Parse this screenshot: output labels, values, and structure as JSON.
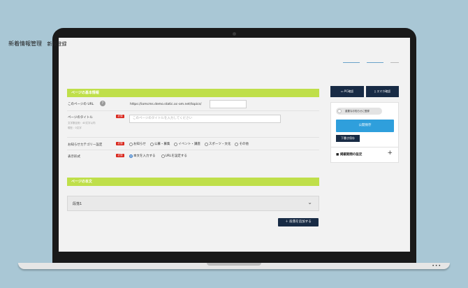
{
  "header": {
    "title": "新着情報管理",
    "subtitle": "新規登録"
  },
  "sections": {
    "basic_info": "ページの基本情報",
    "body": "ページの本文"
  },
  "fields": {
    "url_label": "このページの URL",
    "url_help": "?",
    "url_prefix": "https://iomcms.demo.static.oc-om.net/topics/",
    "url_value": "",
    "title_label": "ページのタイトル",
    "title_hint_1": "文字数目安：40文字以内",
    "title_hint_2": "現在：0文字",
    "title_placeholder": "このページのタイトルを入力してください",
    "required_badge": "必須",
    "category_label": "お知らせカテゴリー設定",
    "category_options": [
      "お知らせ",
      "公募・募集",
      "イベント・講座",
      "スポーツ・文化",
      "その他"
    ],
    "display_label": "表示形式",
    "display_options": [
      "本文を入力する",
      "URLを設定する"
    ]
  },
  "body_section": {
    "paragraph_label": "段落1",
    "add_button": "＋ 段落を追加する"
  },
  "sidebar": {
    "pc_button": "PC確認",
    "phone_button": "スマホ確認",
    "important_toggle": "重要なお知らせに登録",
    "publish_button": "公開保存",
    "draft_button": "下書き保存",
    "period_label": "掲載期間の設定",
    "plus": "+"
  },
  "colors": {
    "section_header": "#bfdf4a",
    "navy": "#182b45",
    "publish": "#2f9fdc",
    "required": "#d9261c",
    "background": "#a9c7d5"
  }
}
